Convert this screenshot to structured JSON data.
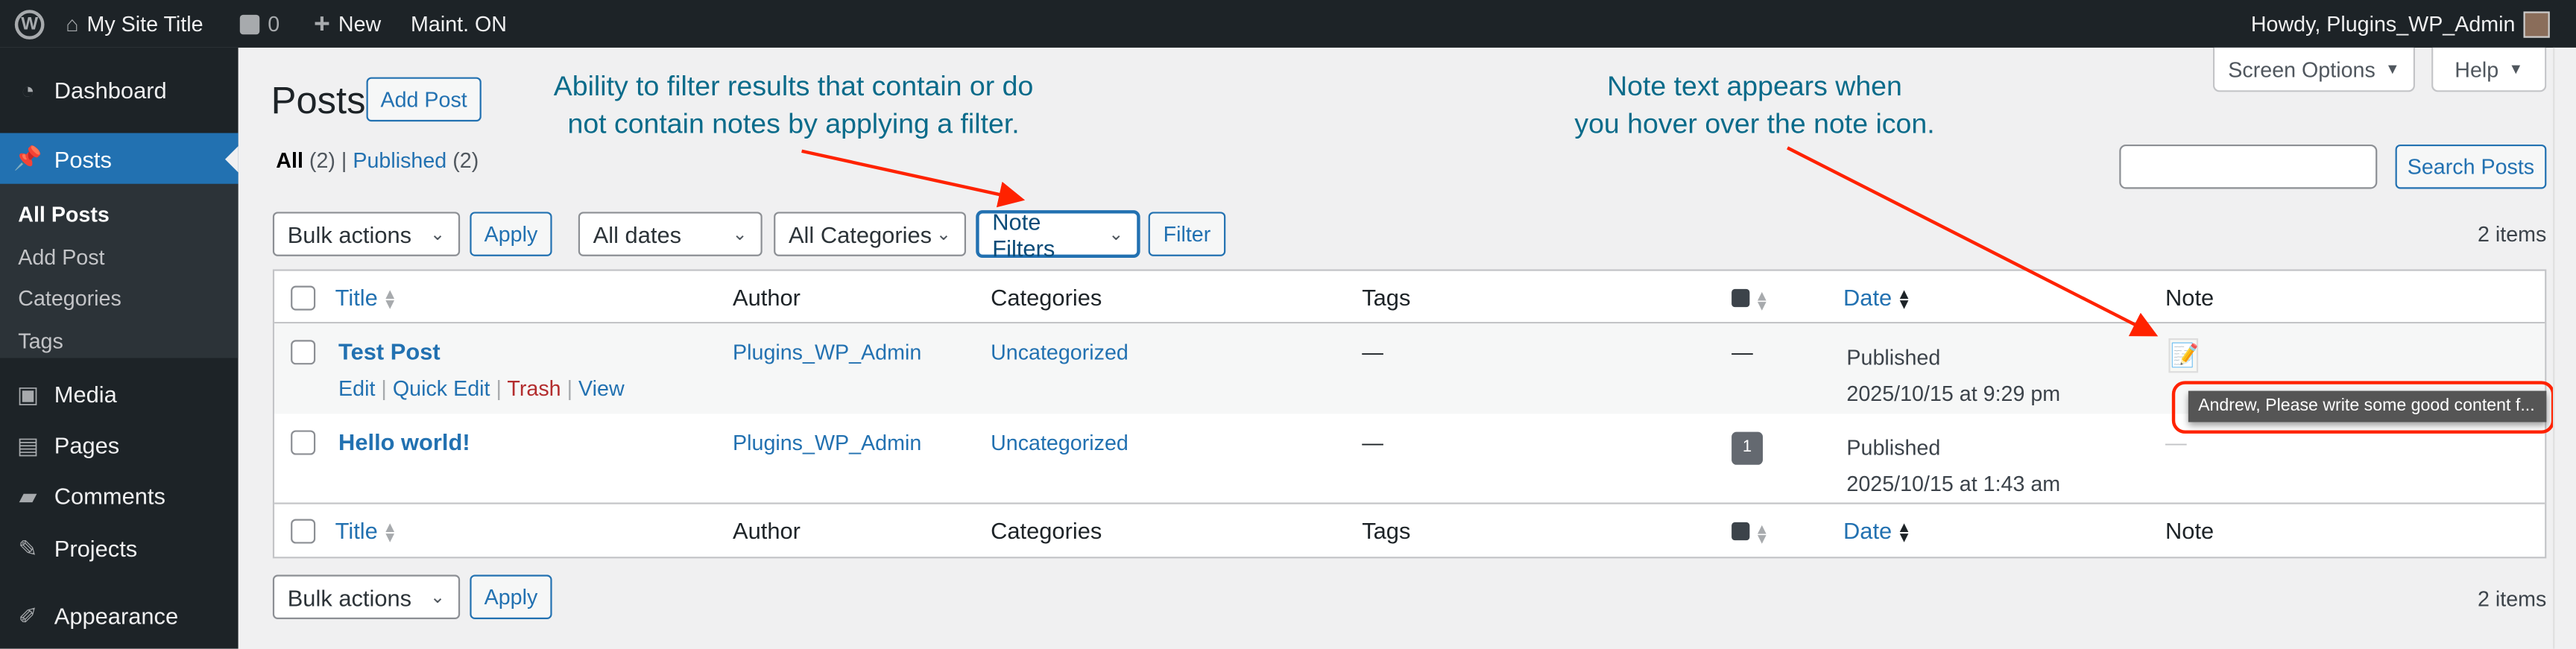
{
  "adminbar": {
    "site_title": "My Site Title",
    "comments_count": "0",
    "new_label": "New",
    "maint": "Maint. ON",
    "howdy": "Howdy, Plugins_WP_Admin"
  },
  "sidebar": {
    "items": [
      {
        "label": "Dashboard",
        "icon": "dashboard-icon"
      },
      {
        "label": "Posts",
        "icon": "pin-icon"
      },
      {
        "label": "Media",
        "icon": "media-icon"
      },
      {
        "label": "Pages",
        "icon": "pages-icon"
      },
      {
        "label": "Comments",
        "icon": "comment-icon"
      },
      {
        "label": "Projects",
        "icon": "pin-icon"
      },
      {
        "label": "Appearance",
        "icon": "brush-icon"
      }
    ],
    "submenu": [
      "All Posts",
      "Add Post",
      "Categories",
      "Tags"
    ]
  },
  "header": {
    "title": "Posts",
    "add_post": "Add Post",
    "screen_options": "Screen Options",
    "help": "Help"
  },
  "views": {
    "all": "All",
    "all_count": "(2)",
    "published": "Published",
    "published_count": "(2)"
  },
  "search": {
    "value": "",
    "button": "Search Posts"
  },
  "filters": {
    "bulk_actions": "Bulk actions",
    "apply": "Apply",
    "dates": "All dates",
    "categories": "All Categories",
    "note_filters": "Note Filters",
    "filter": "Filter",
    "items_count": "2 items"
  },
  "annotations": {
    "left": [
      "Ability to filter results that contain or do",
      "not contain notes by applying a filter."
    ],
    "right": [
      "Note text appears when",
      "you hover over the note icon."
    ],
    "accent": "#ff2200"
  },
  "table": {
    "columns": {
      "title": "Title",
      "author": "Author",
      "categories": "Categories",
      "tags": "Tags",
      "date": "Date",
      "note": "Note"
    },
    "rows": [
      {
        "title": "Test Post",
        "actions": [
          "Edit",
          "Quick Edit",
          "Trash",
          "View"
        ],
        "author": "Plugins_WP_Admin",
        "categories": "Uncategorized",
        "tags": "—",
        "comments": "—",
        "status": "Published",
        "date": "2025/10/15 at 9:29 pm",
        "note_tooltip": "Andrew, Please write some good content f..."
      },
      {
        "title": "Hello world!",
        "author": "Plugins_WP_Admin",
        "categories": "Uncategorized",
        "tags": "—",
        "comments": "1",
        "status": "Published",
        "date": "2025/10/15 at 1:43 am",
        "note": "—"
      }
    ]
  }
}
